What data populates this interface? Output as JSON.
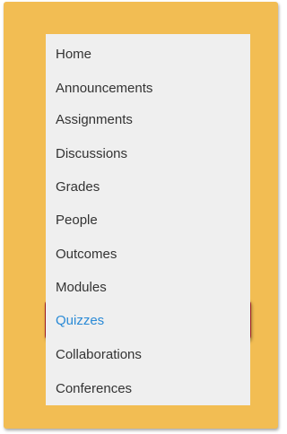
{
  "nav": {
    "items": [
      {
        "label": "Home"
      },
      {
        "label": "Announcements"
      },
      {
        "label": "Assignments"
      },
      {
        "label": "Discussions"
      },
      {
        "label": "Grades"
      },
      {
        "label": "People"
      },
      {
        "label": "Outcomes"
      },
      {
        "label": "Modules"
      },
      {
        "label": "Quizzes",
        "active": true
      },
      {
        "label": "Collaborations"
      },
      {
        "label": "Conferences"
      }
    ]
  },
  "colors": {
    "frame_background": "#f2bd53",
    "nav_background": "#efefef",
    "link_text": "#333333",
    "active_link": "#2a8ad6",
    "highlight_border": "#a01c1c"
  }
}
